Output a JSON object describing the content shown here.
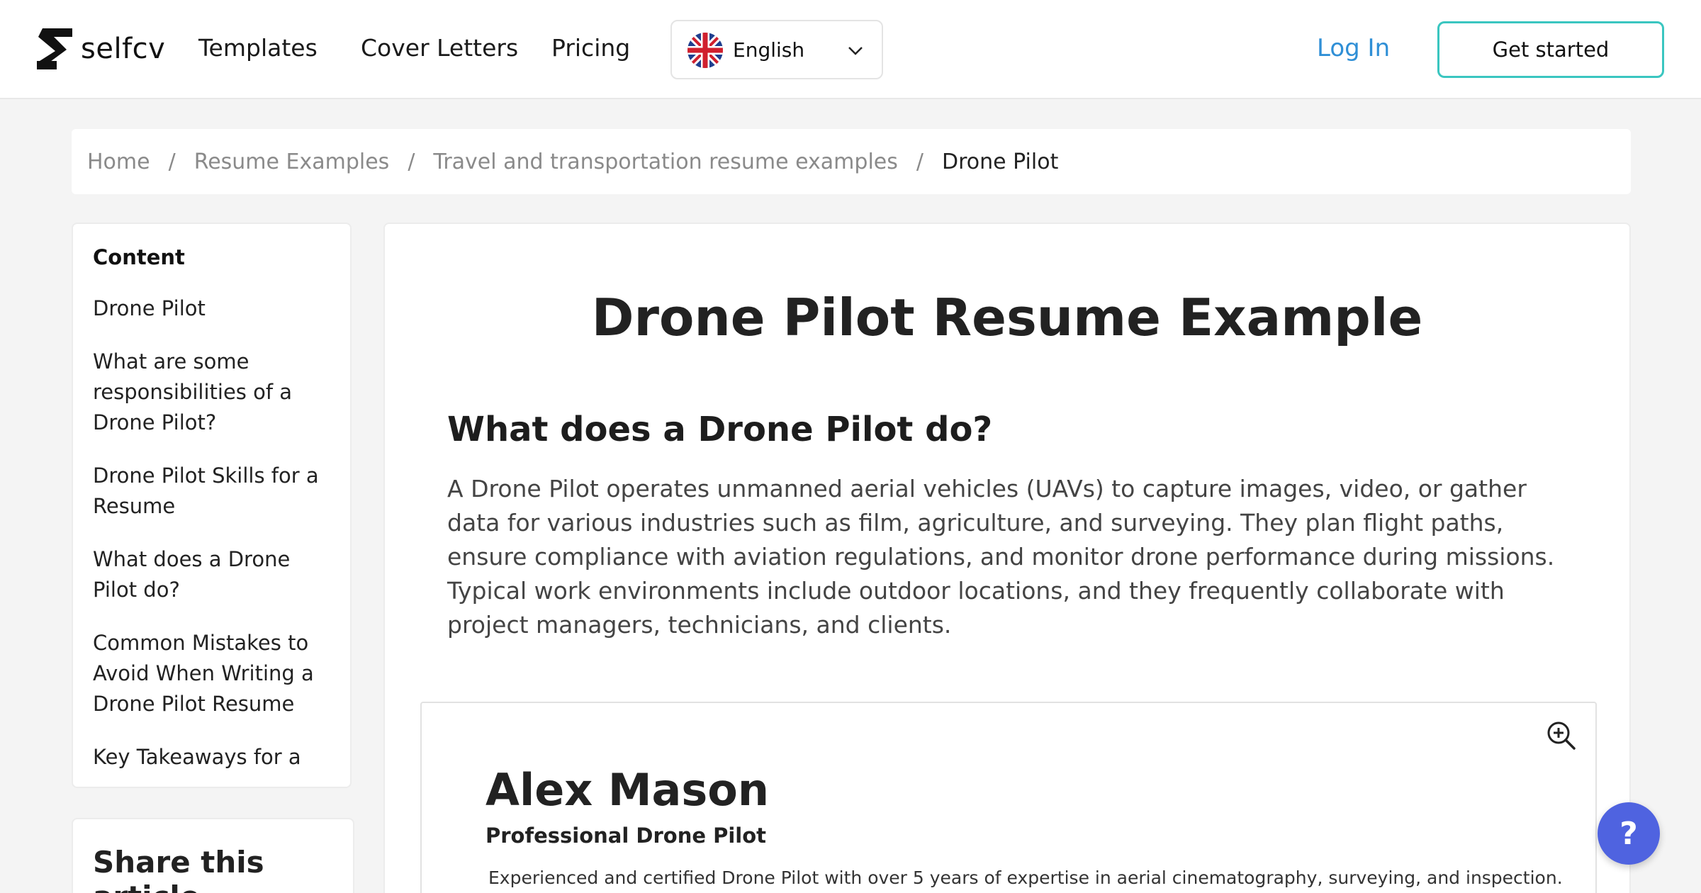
{
  "header": {
    "logo_text": "selfcv",
    "nav": [
      "Templates",
      "Cover Letters",
      "Pricing"
    ],
    "language": "English",
    "login_label": "Log In",
    "cta_label": "Get started"
  },
  "breadcrumb": [
    "Home",
    "Resume Examples",
    "Travel and transportation resume examples",
    "Drone Pilot"
  ],
  "toc": {
    "title": "Content",
    "items": [
      "Drone Pilot",
      "What are some responsibilities of a Drone Pilot?",
      "Drone Pilot Skills for a Resume",
      "What does a Drone Pilot do?",
      "Common Mistakes to Avoid When Writing a Drone Pilot Resume",
      "Key Takeaways for a"
    ]
  },
  "share": {
    "title": "Share this article"
  },
  "main": {
    "title": "Drone Pilot Resume Example",
    "section_heading": "What does a Drone Pilot do?",
    "section_body": "A Drone Pilot operates unmanned aerial vehicles (UAVs) to capture images, video, or gather data for various industries such as film, agriculture, and surveying. They plan flight paths, ensure compliance with aviation regulations, and monitor drone performance during missions. Typical work environments include outdoor locations, and they frequently collaborate with project managers, technicians, and clients."
  },
  "resume": {
    "name": "Alex Mason",
    "role": "Professional Drone Pilot",
    "summary": "Experienced and certified Drone Pilot with over 5 years of expertise in aerial cinematography, surveying, and inspection."
  },
  "help": {
    "label": "?"
  },
  "colors": {
    "accent": "#3ac6c0",
    "link": "#2f8fd6",
    "help": "#4f63e0"
  },
  "icons": {
    "zoom": "zoom-in-icon",
    "chevron": "chevron-down-icon",
    "flag": "uk-flag-icon"
  }
}
